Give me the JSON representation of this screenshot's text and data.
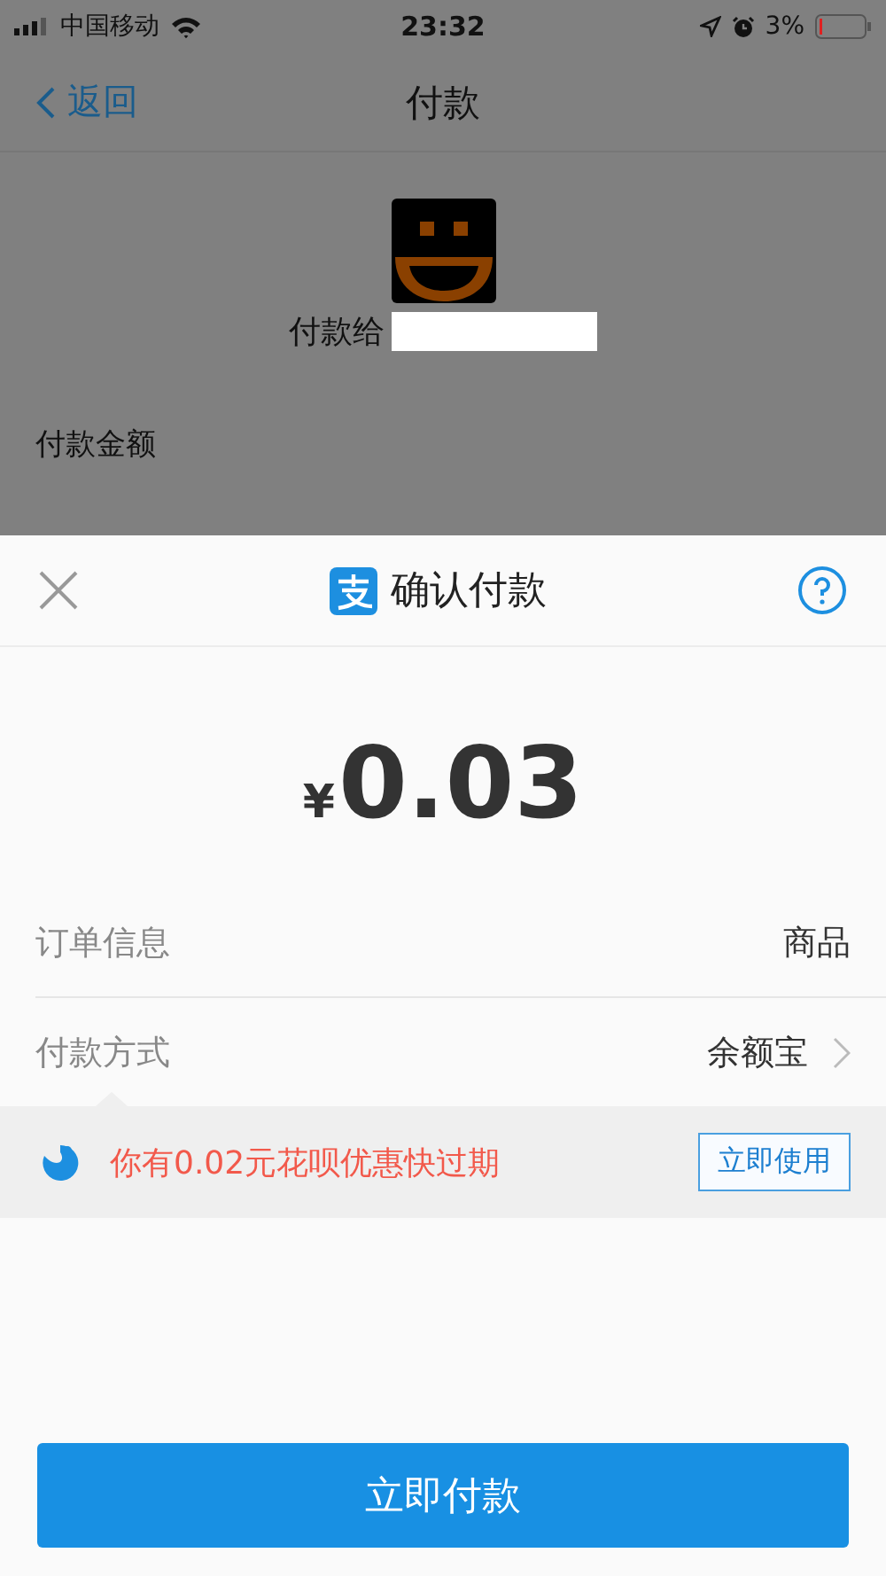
{
  "status_bar": {
    "carrier": "中国移动",
    "time": "23:32",
    "battery": "3%"
  },
  "nav": {
    "back": "返回",
    "title": "付款"
  },
  "payee": {
    "label": "付款给"
  },
  "amount_label": "付款金额",
  "sheet": {
    "title": "确认付款",
    "currency": "¥",
    "amount": "0.03",
    "rows": [
      {
        "label": "订单信息",
        "value": "商品",
        "has_arrow": false
      },
      {
        "label": "付款方式",
        "value": "余额宝",
        "has_arrow": true
      }
    ],
    "promo": {
      "text": "你有0.02元花呗优惠快过期",
      "button": "立即使用"
    },
    "pay_button": "立即付款"
  }
}
